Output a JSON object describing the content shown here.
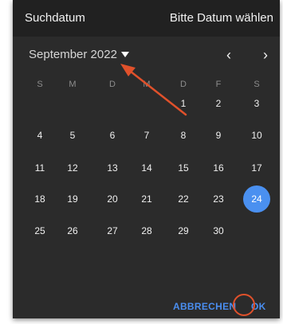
{
  "header": {
    "left_text": "Suchdatum",
    "right_text": "Bitte Datum wählen"
  },
  "calendar": {
    "month_label": "September 2022",
    "month_dropdown_icon": "caret-down-icon",
    "prev_icon": "chevron-left-icon",
    "prev_glyph": "‹",
    "next_icon": "chevron-right-icon",
    "next_glyph": "›",
    "weekdays": [
      "S",
      "M",
      "D",
      "M",
      "D",
      "F",
      "S"
    ],
    "first_weekday_index": 4,
    "days": [
      "1",
      "2",
      "3",
      "4",
      "5",
      "6",
      "7",
      "8",
      "9",
      "10",
      "11",
      "12",
      "13",
      "14",
      "15",
      "16",
      "17",
      "18",
      "19",
      "20",
      "21",
      "22",
      "23",
      "24",
      "25",
      "26",
      "27",
      "28",
      "29",
      "30"
    ],
    "selected_day": "24"
  },
  "actions": {
    "cancel_label": "ABBRECHEN",
    "ok_label": "OK"
  },
  "colors": {
    "dialog_bg": "#2b2b2b",
    "header_bg": "#212121",
    "accent": "#4a90f0",
    "annotation": "#e0512b"
  }
}
